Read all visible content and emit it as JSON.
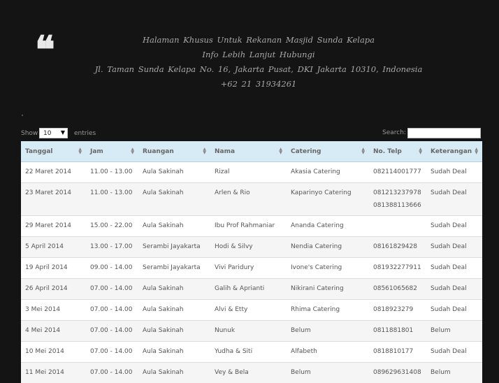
{
  "header": {
    "quote_glyph": "❛❛",
    "line1": "Halaman Khusus Untuk Rekanan Masjid Sunda Kelapa",
    "line2": "Info Lebih Lanjut Hubungi",
    "line3": "Jl. Taman Sunda Kelapa No. 16, Jakarta Pusat, DKI Jakarta 10310, Indonesia",
    "line4": "+62 21 31934261"
  },
  "controls": {
    "show_label": "Show",
    "page_size": "10",
    "entries_label": "entries",
    "search_label": "Search:",
    "search_value": ""
  },
  "table": {
    "columns": [
      "Tanggal",
      "Jam",
      "Ruangan",
      "Nama",
      "Catering",
      "No. Telp",
      "Keterangan"
    ],
    "rows": [
      {
        "tanggal": "22 Maret 2014",
        "jam": "11.00 - 13.00",
        "ruangan": "Aula Sakinah",
        "nama": "Rizal",
        "catering": "Akasia Catering",
        "telp": "082114001777",
        "telp2": "",
        "ket": "Sudah Deal"
      },
      {
        "tanggal": "23 Maret 2014",
        "jam": "11.00 - 13.00",
        "ruangan": "Aula Sakinah",
        "nama": "Arlen & Rio",
        "catering": "Kaparinyo Catering",
        "telp": "081213237978",
        "telp2": "081388113666",
        "ket": "Sudah Deal"
      },
      {
        "tanggal": "29 Maret 2014",
        "jam": "15.00 - 22.00",
        "ruangan": "Aula Sakinah",
        "nama": "Ibu Prof Rahmaniar",
        "catering": "Ananda Catering",
        "telp": "",
        "telp2": "",
        "ket": "Sudah Deal"
      },
      {
        "tanggal": "5 April 2014",
        "jam": "13.00 - 17.00",
        "ruangan": "Serambi Jayakarta",
        "nama": "Hodi & Silvy",
        "catering": "Nendia Catering",
        "telp": "08161829428",
        "telp2": "",
        "ket": "Sudah Deal"
      },
      {
        "tanggal": "19 April 2014",
        "jam": "09.00 - 14.00",
        "ruangan": "Serambi Jayakarta",
        "nama": "Vivi Paridury",
        "catering": "Ivone's Catering",
        "telp": "081932277911",
        "telp2": "",
        "ket": "Sudah Deal"
      },
      {
        "tanggal": "26 April 2014",
        "jam": "07.00 - 14.00",
        "ruangan": "Aula Sakinah",
        "nama": "Galih & Aprianti",
        "catering": "Nikirani Catering",
        "telp": "08561065682",
        "telp2": "",
        "ket": "Sudah Deal"
      },
      {
        "tanggal": "3 Mei 2014",
        "jam": "07.00 - 14.00",
        "ruangan": "Aula Sakinah",
        "nama": "Alvi & Etty",
        "catering": "Rhima Catering",
        "telp": "0818923279",
        "telp2": "",
        "ket": "Sudah Deal"
      },
      {
        "tanggal": "4 Mei 2014",
        "jam": "07.00 - 14.00",
        "ruangan": "Aula Sakinah",
        "nama": "Nunuk",
        "catering": "Belum",
        "telp": "0811881801",
        "telp2": "",
        "ket": "Belum"
      },
      {
        "tanggal": "10 Mei 2014",
        "jam": "07.00 - 14.00",
        "ruangan": "Aula Sakinah",
        "nama": "Yudha & Siti",
        "catering": "Alfabeth",
        "telp": "0818810177",
        "telp2": "",
        "ket": "Sudah Deal"
      },
      {
        "tanggal": "11 Mei 2014",
        "jam": "07.00 - 14.00",
        "ruangan": "Aula Sakinah",
        "nama": "Vey & Bela",
        "catering": "Belum",
        "telp": "089629631408",
        "telp2": "",
        "ket": "Belum"
      }
    ]
  },
  "colors": {
    "page_background": "#141414",
    "header_row": "#d7ebf6",
    "info_text": "#a8a8a8"
  }
}
